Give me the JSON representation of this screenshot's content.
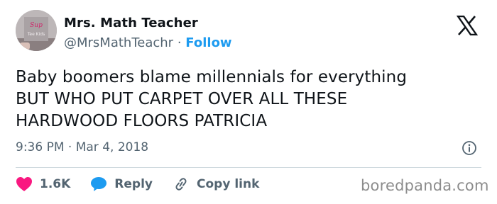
{
  "author": {
    "name": "Mrs. Math Teacher",
    "handle": "@MrsMathTeachr",
    "separator": "·",
    "follow_label": "Follow",
    "avatar_text": [
      "Sup",
      "Tee Kids"
    ]
  },
  "tweet": {
    "lines": [
      "Baby boomers blame millennials for everything",
      "BUT WHO PUT CARPET OVER ALL THESE",
      "HARDWOOD FLOORS PATRICIA"
    ],
    "time": "9:36 PM",
    "separator": "·",
    "date": "Mar 4, 2018"
  },
  "actions": {
    "like_count": "1.6K",
    "reply_label": "Reply",
    "copy_label": "Copy link"
  },
  "watermark": "boredpanda.com",
  "colors": {
    "accent": "#1d9bf0",
    "like": "#f91880",
    "muted": "#536471",
    "text": "#0f1419"
  },
  "icons": {
    "brand": "x-logo-icon",
    "like": "heart-icon",
    "reply": "speech-bubble-icon",
    "copy": "link-icon",
    "info": "info-icon"
  }
}
